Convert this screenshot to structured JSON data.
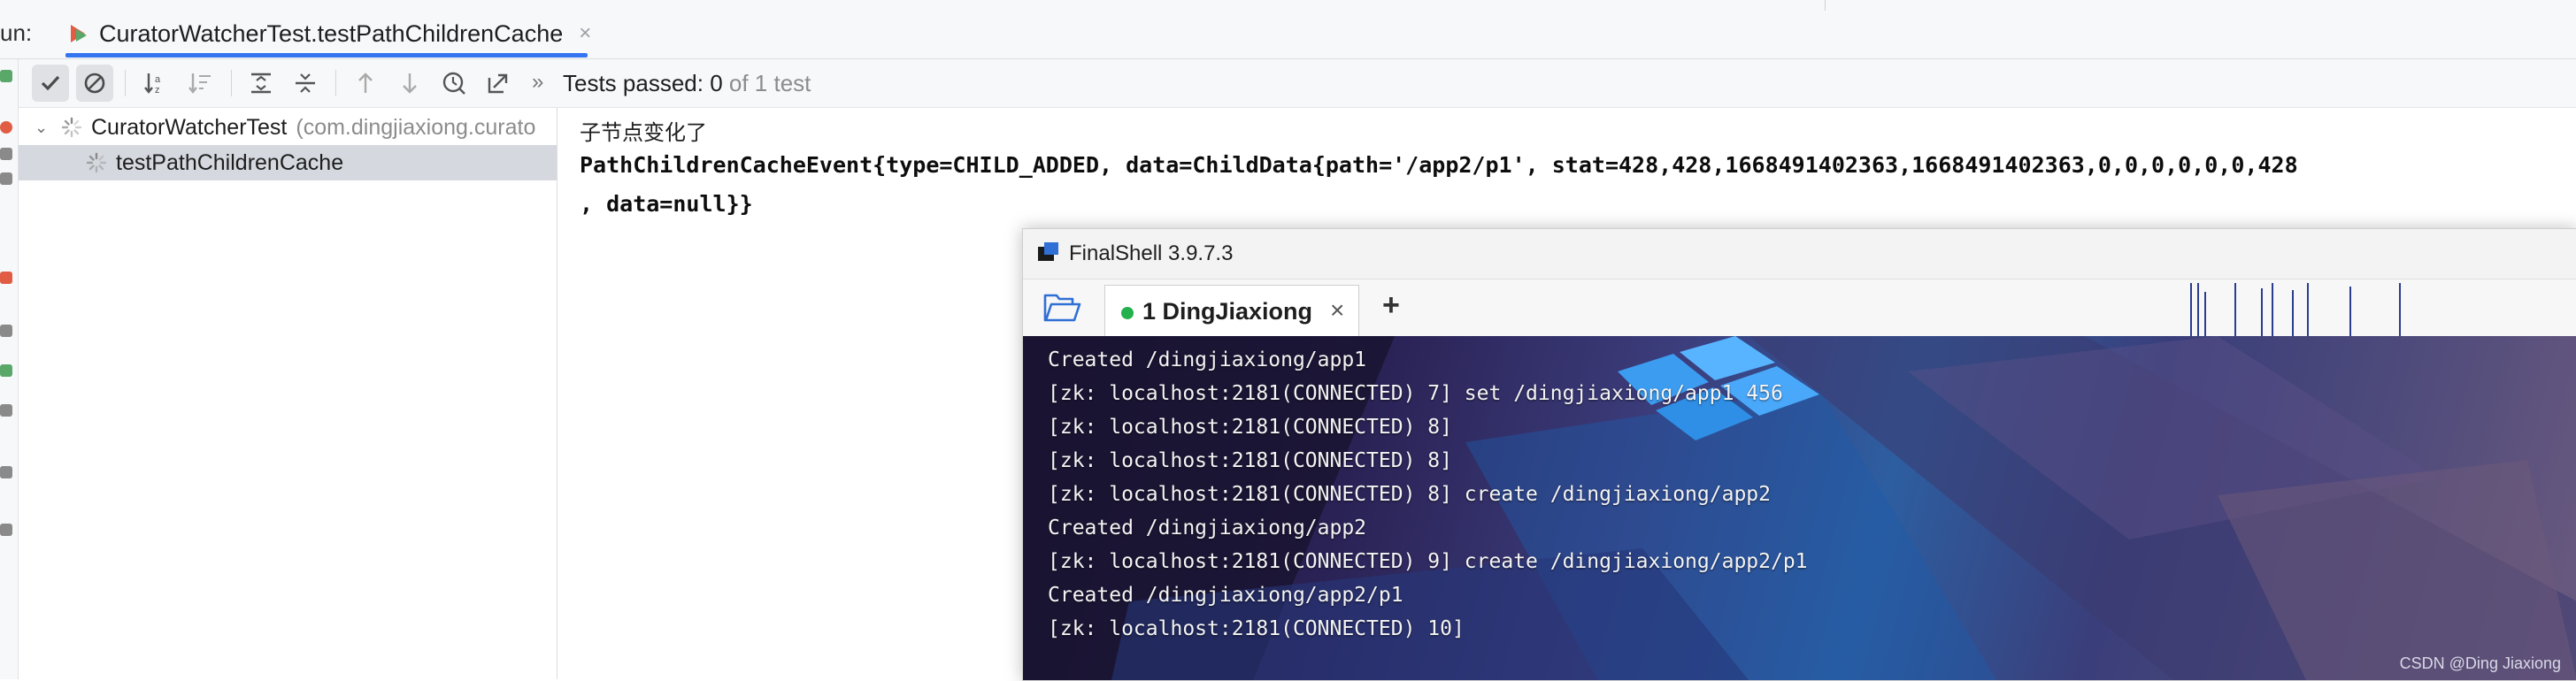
{
  "ide": {
    "run_label": "un:",
    "run_tab_title": "CuratorWatcherTest.testPathChildrenCache",
    "run_tab_close": "×",
    "toolbar": {
      "tests_status_prefix": "Tests passed: 0",
      "tests_status_suffix": " of 1 test",
      "overflow": "»"
    },
    "tree": {
      "root_chevron": "⌄",
      "root_label": "CuratorWatcherTest",
      "root_package": "(com.dingjiaxiong.curato",
      "child_label": "testPathChildrenCache"
    },
    "console": {
      "line1": "子节点变化了",
      "line2": "PathChildrenCacheEvent{type=CHILD_ADDED, data=ChildData{path='/app2/p1', stat=428,428,1668491402363,1668491402363,0,0,0,0,0,0,428",
      "line3": ", data=null}}"
    }
  },
  "finalshell": {
    "title": "FinalShell 3.9.7.3",
    "tab_label": "1 DingJiaxiong",
    "tab_close": "×",
    "add_tab": "+",
    "terminal_lines": [
      "Created /dingjiaxiong/app1",
      "[zk: localhost:2181(CONNECTED) 7] set /dingjiaxiong/app1 456",
      "[zk: localhost:2181(CONNECTED) 8]",
      "[zk: localhost:2181(CONNECTED) 8]",
      "[zk: localhost:2181(CONNECTED) 8] create /dingjiaxiong/app2",
      "Created /dingjiaxiong/app2",
      "[zk: localhost:2181(CONNECTED) 9] create /dingjiaxiong/app2/p1",
      "Created /dingjiaxiong/app2/p1",
      "[zk: localhost:2181(CONNECTED) 10]"
    ],
    "watermark": "CSDN @Ding Jiaxiong"
  },
  "colors": {
    "accent": "#3574f0",
    "status_green": "#22b14c",
    "selection": "#d5d8de"
  },
  "icons": {
    "toolbar": [
      "check-icon",
      "cancel-icon",
      "sort-alpha-icon",
      "sort-duration-icon",
      "expand-all-icon",
      "collapse-all-icon",
      "prev-failed-icon",
      "next-failed-icon",
      "history-icon",
      "export-icon"
    ],
    "side_strip": [
      "rerun-icon",
      "stop-icon",
      "settings-icon",
      "pin-icon"
    ]
  }
}
